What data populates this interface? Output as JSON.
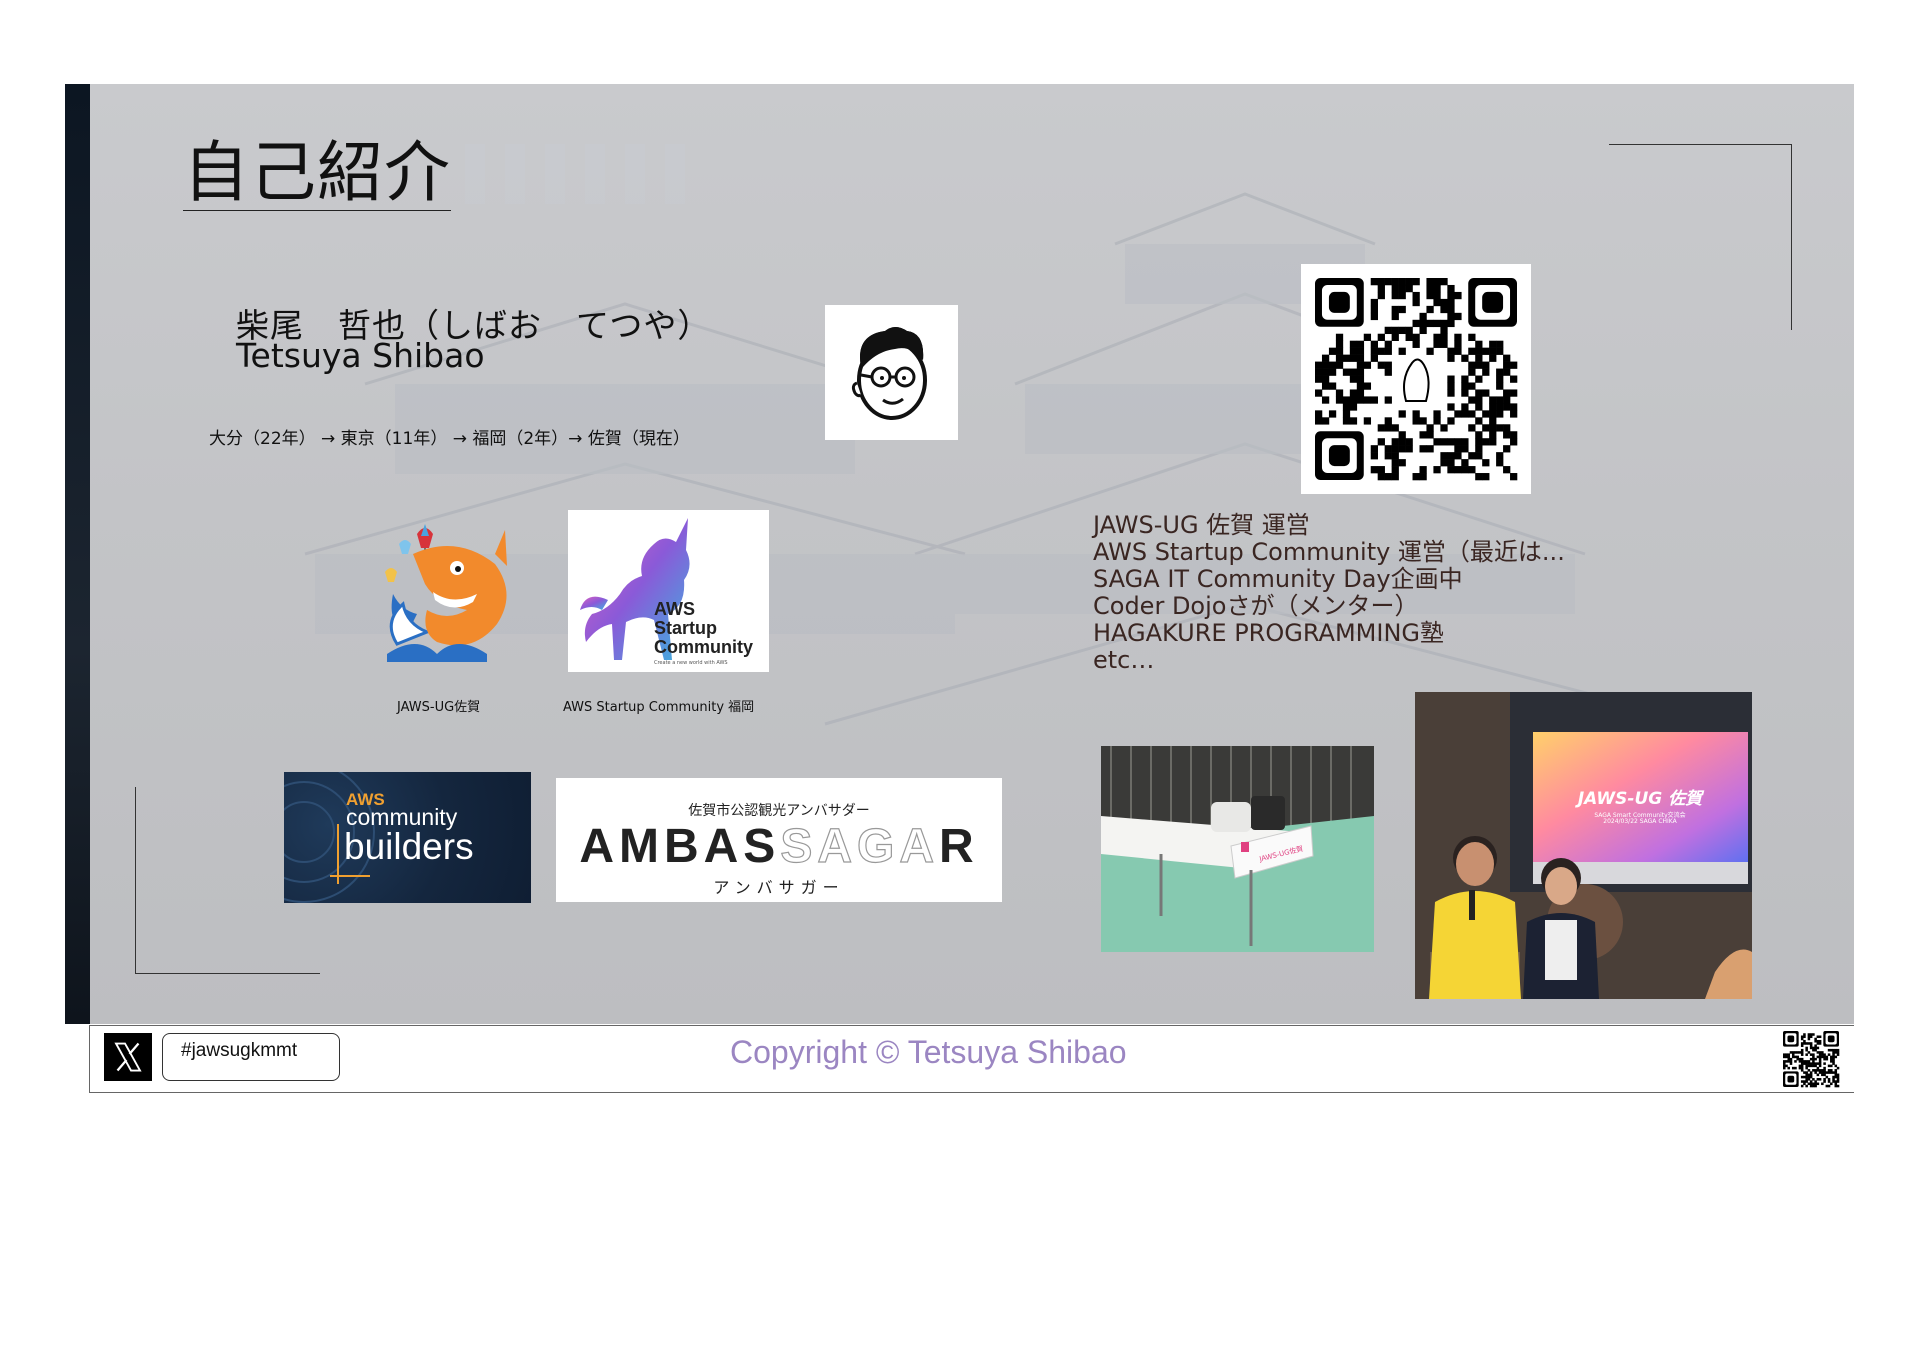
{
  "slide": {
    "title": "自己紹介",
    "name_jp": "柴尾　哲也（しばお　てつや）",
    "name_en": "Tetsuya Shibao",
    "history": "大分（22年） → 東京（11年） → 福岡（2年）→ 佐賀（現在）",
    "activities": [
      "JAWS-UG 佐賀 運営",
      "AWS Startup Community 運営（最近は...",
      "SAGA IT Community Day企画中",
      "Coder Dojoさが（メンター）",
      "HAGAKURE PROGRAMMING塾",
      "etc…"
    ],
    "captions": {
      "jaws_ug_saga": "JAWS-UG佐賀",
      "aws_startup_fukuoka": "AWS Startup Community 福岡"
    },
    "logos": {
      "unicorn_line1": "AWS",
      "unicorn_line2": "Startup",
      "unicorn_line3": "Community",
      "unicorn_tagline": "Create a new world with AWS",
      "builders_aws": "AWS",
      "builders_community": "community",
      "builders_builders": "builders",
      "ambassagar_sub": "佐賀市公認観光アンバサダー",
      "ambassagar_main_a": "AMBAS",
      "ambassagar_main_b": "SAGA",
      "ambassagar_main_c": "R",
      "ambassagar_kana": "アンバサガー",
      "tablecloth_text": "JAWS-UG佐賀",
      "screen_title": "JAWS-UG 佐賀",
      "screen_sub1": "SAGA Smart Community交流会",
      "screen_sub2": "2024/03/22 SAGA CHIKA"
    }
  },
  "footer": {
    "hashtag": "#jawsugkmmt",
    "copyright": "Copyright © Tetsuya Shibao"
  },
  "colors": {
    "copyright": "#9b86c2",
    "activities_text": "#3a2622",
    "builders_accent": "#f0a030"
  },
  "icons": {
    "x": "x-logo-icon",
    "avatar": "avatar-icon",
    "qr": "qr-code-icon"
  }
}
